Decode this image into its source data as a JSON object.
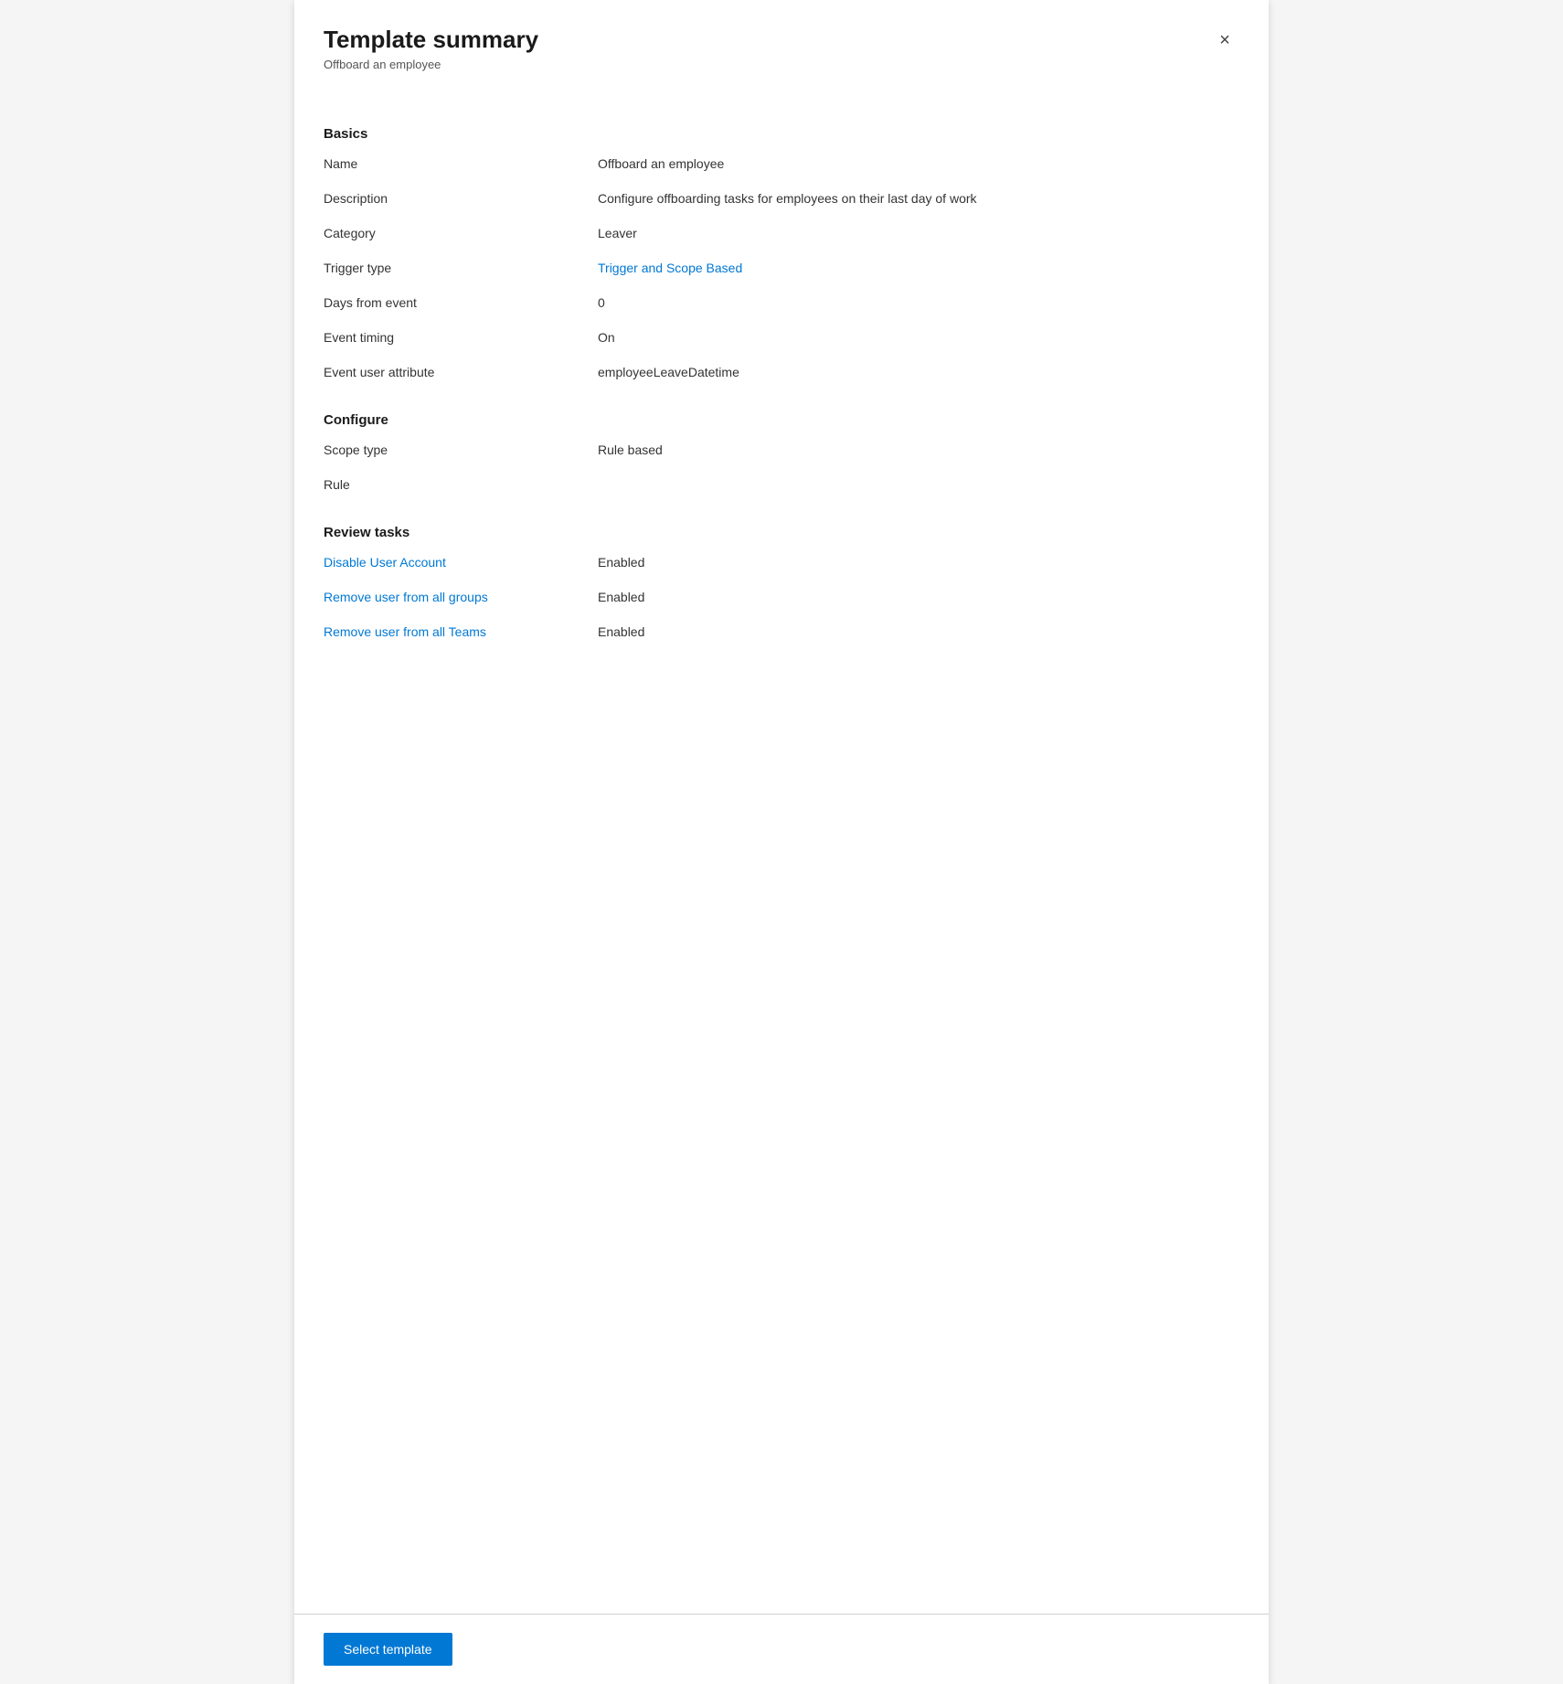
{
  "panel": {
    "title": "Template summary",
    "subtitle": "Offboard an employee",
    "close_icon": "×"
  },
  "sections": {
    "basics": {
      "heading": "Basics",
      "fields": [
        {
          "label": "Name",
          "value": "Offboard an employee",
          "link": false
        },
        {
          "label": "Description",
          "value": "Configure offboarding tasks for employees on their last day of work",
          "link": false
        },
        {
          "label": "Category",
          "value": "Leaver",
          "link": false
        },
        {
          "label": "Trigger type",
          "value": "Trigger and Scope Based",
          "link": true
        },
        {
          "label": "Days from event",
          "value": "0",
          "link": false
        },
        {
          "label": "Event timing",
          "value": "On",
          "link": false
        },
        {
          "label": "Event user attribute",
          "value": "employeeLeaveDatetime",
          "link": false
        }
      ]
    },
    "configure": {
      "heading": "Configure",
      "fields": [
        {
          "label": "Scope type",
          "value": "Rule based",
          "link": false
        },
        {
          "label": "Rule",
          "value": "",
          "link": false
        }
      ]
    },
    "review_tasks": {
      "heading": "Review tasks",
      "fields": [
        {
          "label": "Disable User Account",
          "value": "Enabled",
          "link": true
        },
        {
          "label": "Remove user from all groups",
          "value": "Enabled",
          "link": true
        },
        {
          "label": "Remove user from all Teams",
          "value": "Enabled",
          "link": true
        }
      ]
    }
  },
  "footer": {
    "select_template_label": "Select template"
  }
}
